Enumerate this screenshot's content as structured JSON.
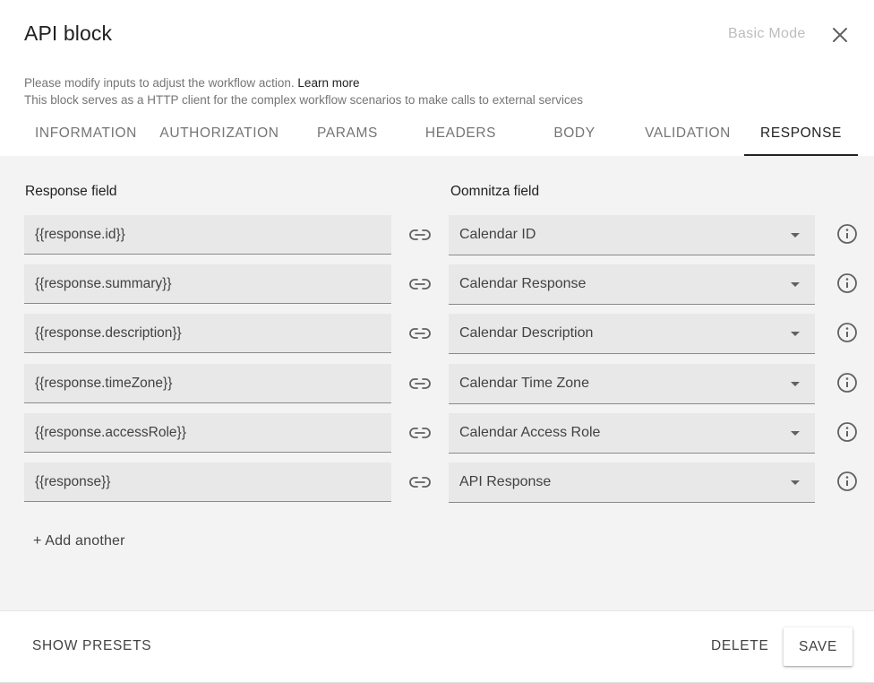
{
  "dialog": {
    "title": "API block",
    "mode_toggle": "Basic Mode",
    "close_icon": "close-icon"
  },
  "subtitle": {
    "line1": "Please modify inputs to adjust the workflow action.",
    "learn_more": "Learn more",
    "line2": "This block serves as a HTTP client for the complex workflow scenarios to make calls to external services"
  },
  "tabs": [
    {
      "label": "INFORMATION",
      "active": false
    },
    {
      "label": "AUTHORIZATION",
      "active": false
    },
    {
      "label": "PARAMS",
      "active": false
    },
    {
      "label": "HEADERS",
      "active": false
    },
    {
      "label": "BODY",
      "active": false
    },
    {
      "label": "VALIDATION",
      "active": false
    },
    {
      "label": "RESPONSE",
      "active": true
    }
  ],
  "response": {
    "response_field_header": "Response field",
    "oomnitza_field_header": "Oomnitza field",
    "mappings": [
      {
        "response_field": "{{response.id}}",
        "oomnitza_field": "Calendar ID"
      },
      {
        "response_field": "{{response.summary}}",
        "oomnitza_field": "Calendar Response"
      },
      {
        "response_field": "{{response.description}}",
        "oomnitza_field": "Calendar Description"
      },
      {
        "response_field": "{{response.timeZone}}",
        "oomnitza_field": "Calendar Time Zone"
      },
      {
        "response_field": "{{response.accessRole}}",
        "oomnitza_field": "Calendar Access Role"
      },
      {
        "response_field": "{{response}}",
        "oomnitza_field": "API Response"
      }
    ],
    "add_another": "+ Add another",
    "icons": {
      "link": "link-icon",
      "info": "info-icon",
      "dropdown": "chevron-down-icon"
    }
  },
  "footer": {
    "show_presets": "SHOW PRESETS",
    "delete": "DELETE",
    "save": "SAVE"
  },
  "colors": {
    "panel_background": "#f3f3f3",
    "field_background": "#e8e8e8",
    "active_tab": "#212121",
    "inactive_tab": "#757575",
    "muted": "#bdbdbd"
  }
}
